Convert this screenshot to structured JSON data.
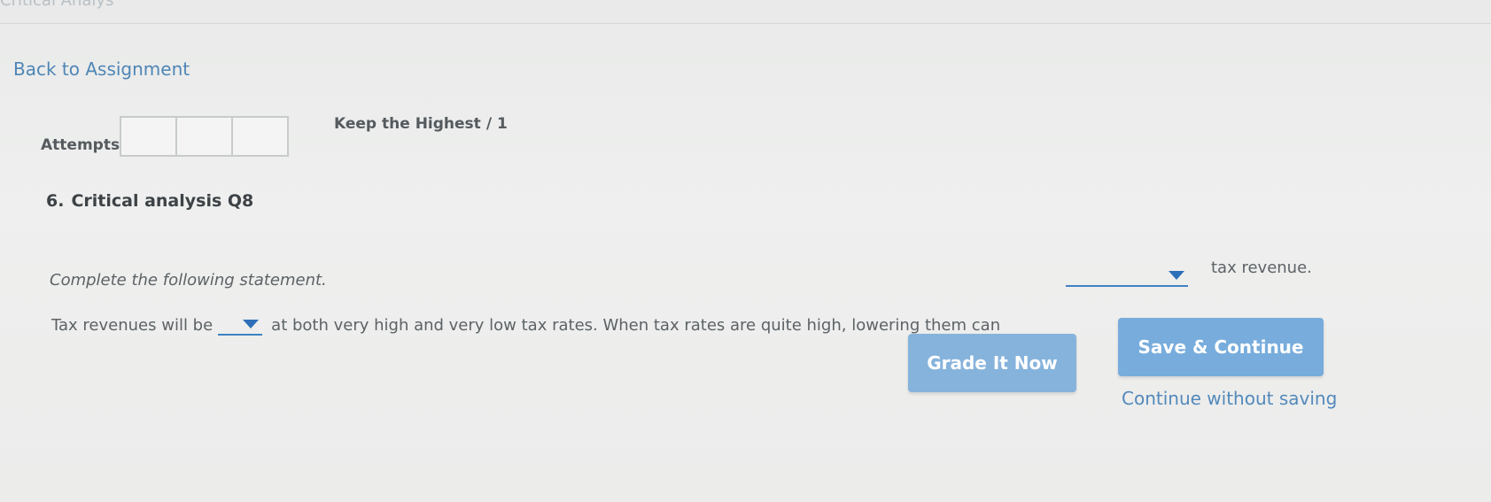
{
  "header": {
    "crumb": "Critical Analys",
    "back_link": "Back to Assignment"
  },
  "attempts": {
    "label": "Attempts",
    "boxes": [
      "",
      "",
      ""
    ],
    "keep_label": "Keep the Highest",
    "score": "/ 1"
  },
  "question": {
    "number": "6.",
    "title": "Critical analysis Q8",
    "instruction": "Complete the following statement.",
    "part1_prefix": "Tax revenues will be",
    "part1_suffix": "at both very high and very low tax rates. When tax rates are quite high, lowering them can",
    "part2_suffix": "tax revenue.",
    "dropdown1_value": "",
    "dropdown2_value": ""
  },
  "actions": {
    "grade_label": "Grade It Now",
    "save_label": "Save & Continue",
    "continue_label": "Continue without saving"
  },
  "colors": {
    "accent": "#3f82c2",
    "button_bg": "#77acdc",
    "link": "#4f86b6"
  }
}
